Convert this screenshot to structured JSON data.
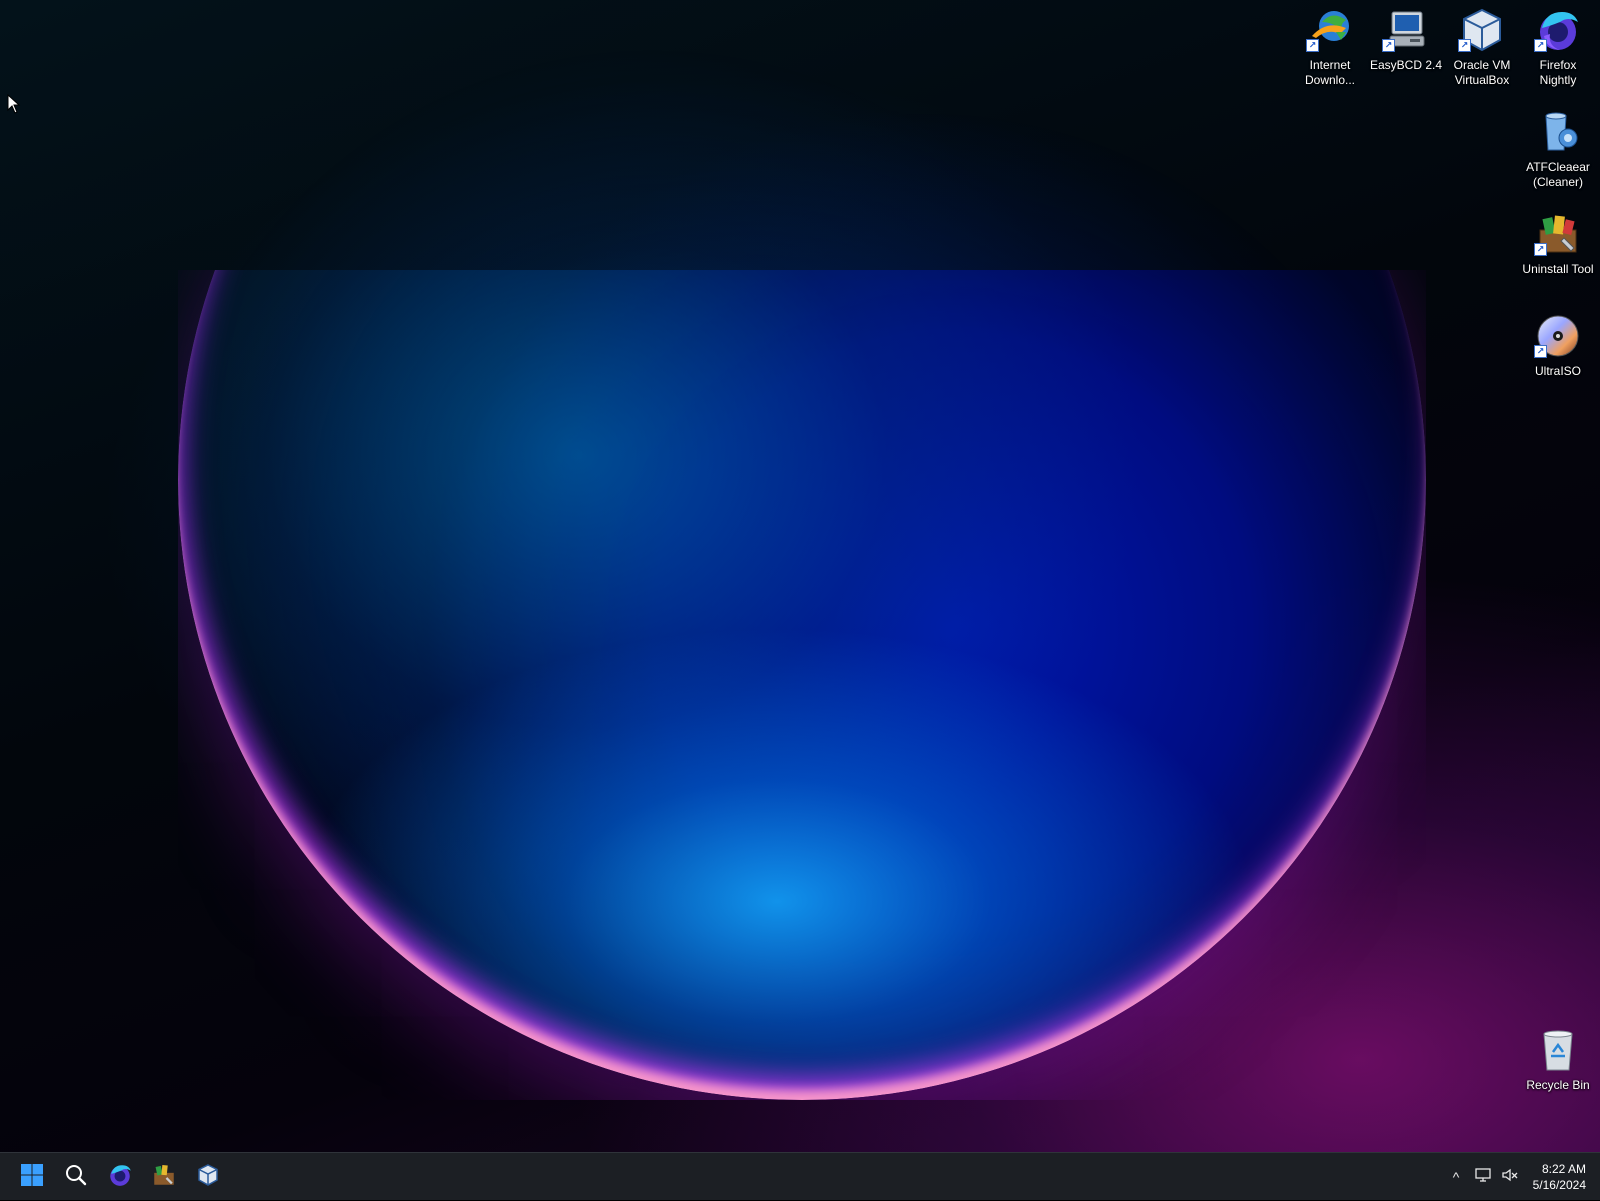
{
  "desktop": {
    "icons": [
      {
        "label_line1": "Internet",
        "label_line2": "Downlo...",
        "icon": "internet-download-manager-icon",
        "shortcut": true
      },
      {
        "label_line1": "EasyBCD 2.4",
        "label_line2": "",
        "icon": "easybcd-icon",
        "shortcut": true
      },
      {
        "label_line1": "Oracle VM",
        "label_line2": "VirtualBox",
        "icon": "virtualbox-icon",
        "shortcut": true
      },
      {
        "label_line1": "Firefox",
        "label_line2": "Nightly",
        "icon": "firefox-nightly-icon",
        "shortcut": true
      },
      {
        "label_line1": "ATFCleaear",
        "label_line2": "(Cleaner)",
        "icon": "atfcleaner-icon",
        "shortcut": false
      },
      {
        "label_line1": "Uninstall Tool",
        "label_line2": "",
        "icon": "uninstall-tool-icon",
        "shortcut": true
      },
      {
        "label_line1": "UltraISO",
        "label_line2": "",
        "icon": "ultraiso-icon",
        "shortcut": true
      },
      {
        "label_line1": "Recycle Bin",
        "label_line2": "",
        "icon": "recycle-bin-icon",
        "shortcut": false
      }
    ]
  },
  "taskbar": {
    "pinned": [
      {
        "name": "start",
        "icon": "windows-start-icon"
      },
      {
        "name": "search",
        "icon": "search-icon"
      },
      {
        "name": "firefox",
        "icon": "firefox-nightly-icon"
      },
      {
        "name": "uninstall-tool",
        "icon": "uninstall-tool-icon"
      },
      {
        "name": "virtualbox",
        "icon": "virtualbox-icon"
      }
    ],
    "tray": {
      "chevron": "^",
      "time": "8:22 AM",
      "date": "5/16/2024"
    }
  },
  "colors": {
    "taskbar_bg": "#1c1f24",
    "windows_blue": "#3aa0ff"
  }
}
